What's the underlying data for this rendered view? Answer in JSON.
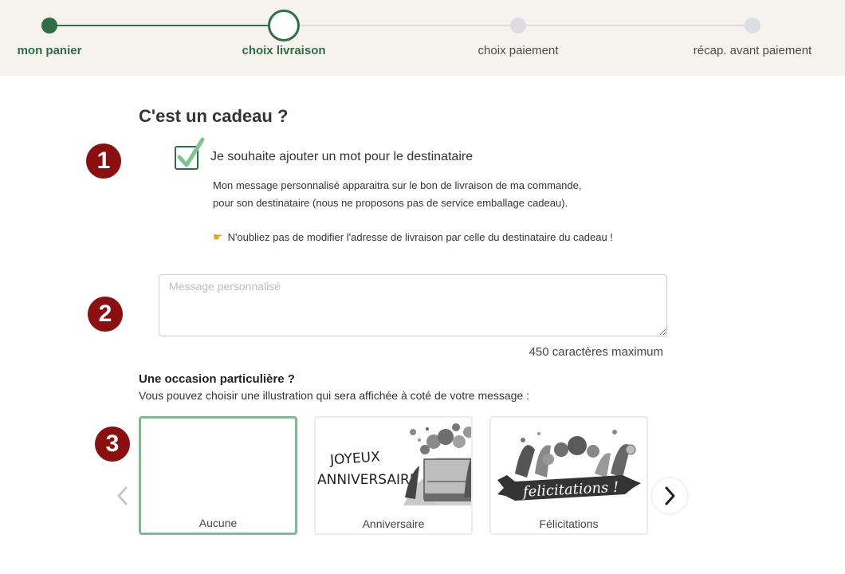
{
  "stepper": {
    "steps": [
      {
        "label": "mon panier",
        "state": "done"
      },
      {
        "label": "choix livraison",
        "state": "current"
      },
      {
        "label": "choix paiement",
        "state": "todo"
      },
      {
        "label": "récap. avant paiement",
        "state": "todo"
      }
    ]
  },
  "badges": [
    "1",
    "2",
    "3"
  ],
  "gift": {
    "title": "C'est un cadeau ?",
    "checkbox_label": "Je souhaite ajouter un mot pour le destinataire",
    "checked": true,
    "info_line1": "Mon message personnalisé apparaitra sur le bon de livraison de ma commande,",
    "info_line2": "pour son destinataire (nous ne proposons pas de service emballage cadeau).",
    "reminder": "N'oubliez pas de modifier l'adresse de livraison par celle du destinataire du cadeau !",
    "reminder_icon": "pointing-hand-icon"
  },
  "message": {
    "placeholder": "Message personnalisé",
    "value": "",
    "max_label": "450 caractères maximum"
  },
  "occasion": {
    "title": "Une occasion particulière ?",
    "subtitle": "Vous pouvez choisir une illustration qui sera affichée à coté de votre message :",
    "cards": [
      {
        "label": "Aucune",
        "selected": true
      },
      {
        "label": "Anniversaire",
        "selected": false,
        "art_text1": "JOYEUX",
        "art_text2": "ANNIVERSAIRE !"
      },
      {
        "label": "Félicitations",
        "selected": false,
        "art_text": "felicitations !"
      }
    ]
  },
  "colors": {
    "accent": "#2d6e46",
    "badge": "#8b0f0f",
    "selected_border": "#7fb98f",
    "stepper_bg": "#f6f3ef"
  }
}
